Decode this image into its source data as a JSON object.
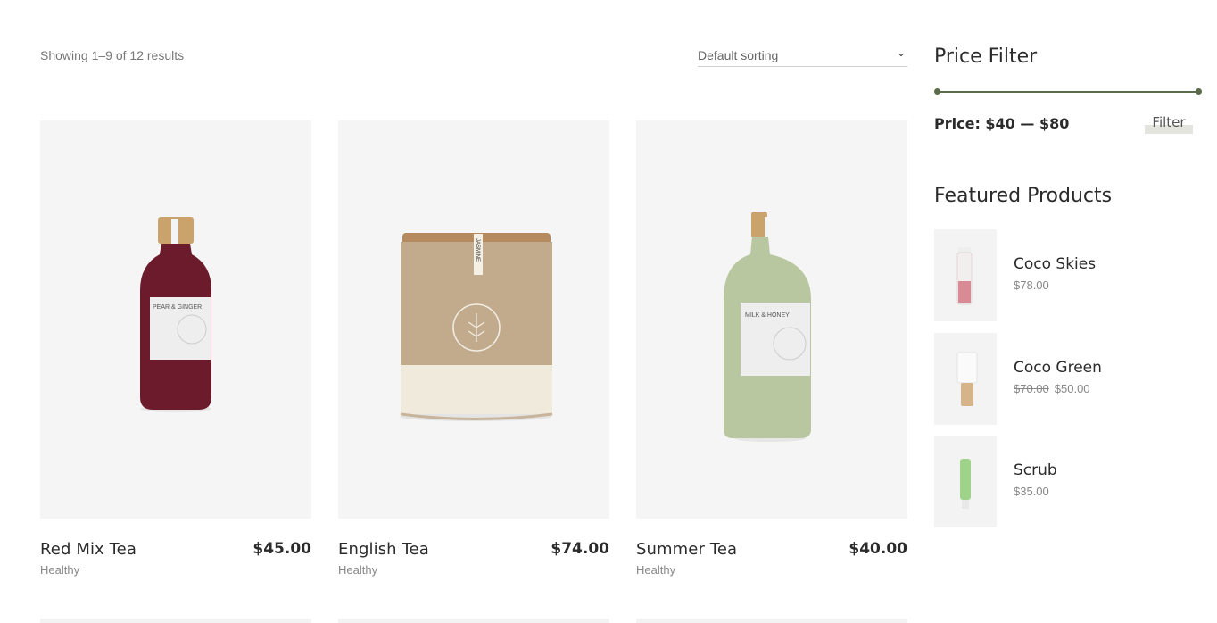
{
  "shop": {
    "results_count": "Showing 1–9 of 12 results",
    "sorting": {
      "selected": "Default sorting"
    }
  },
  "products": [
    {
      "name": "Red Mix Tea",
      "price": "$45.00",
      "category": "Healthy",
      "label": "PEAR & GINGER"
    },
    {
      "name": "English Tea",
      "price": "$74.00",
      "category": "Healthy",
      "label": "JASMINE"
    },
    {
      "name": "Summer Tea",
      "price": "$40.00",
      "category": "Healthy",
      "label": "MILK & HONEY"
    }
  ],
  "sidebar": {
    "price_filter": {
      "title": "Price Filter",
      "range_text": "Price: $40 — $80",
      "filter_label": "Filter",
      "min": 40,
      "max": 80,
      "accent": "#5c6b4a"
    },
    "featured": {
      "title": "Featured Products",
      "items": [
        {
          "name": "Coco Skies",
          "old_price": "",
          "price": "$78.00"
        },
        {
          "name": "Coco Green",
          "old_price": "$70.00",
          "price": "$50.00"
        },
        {
          "name": "Scrub",
          "old_price": "",
          "price": "$35.00"
        }
      ]
    }
  }
}
